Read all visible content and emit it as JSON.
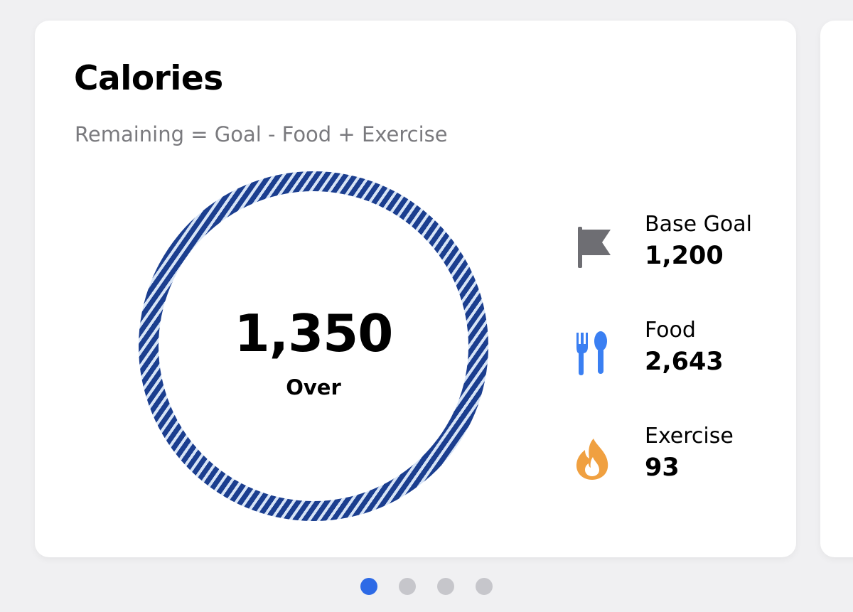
{
  "card": {
    "title": "Calories",
    "subtitle": "Remaining = Goal - Food + Exercise"
  },
  "ring": {
    "value": "1,350",
    "label": "Over",
    "stripe_color": "#1b3e8f",
    "stripe_light_color": "#d7e4f6"
  },
  "stats": {
    "base_goal": {
      "icon": "flag-icon",
      "label": "Base Goal",
      "value": "1,200",
      "color": "#6e6e73"
    },
    "food": {
      "icon": "fork-spoon-icon",
      "label": "Food",
      "value": "2,643",
      "color": "#3a7ff2"
    },
    "exercise": {
      "icon": "flame-icon",
      "label": "Exercise",
      "value": "93",
      "color": "#f0a040"
    }
  },
  "pagination": {
    "page_count": 4,
    "active_index": 0,
    "active_color": "#2d6ae6",
    "inactive_color": "#c6c6cb"
  }
}
